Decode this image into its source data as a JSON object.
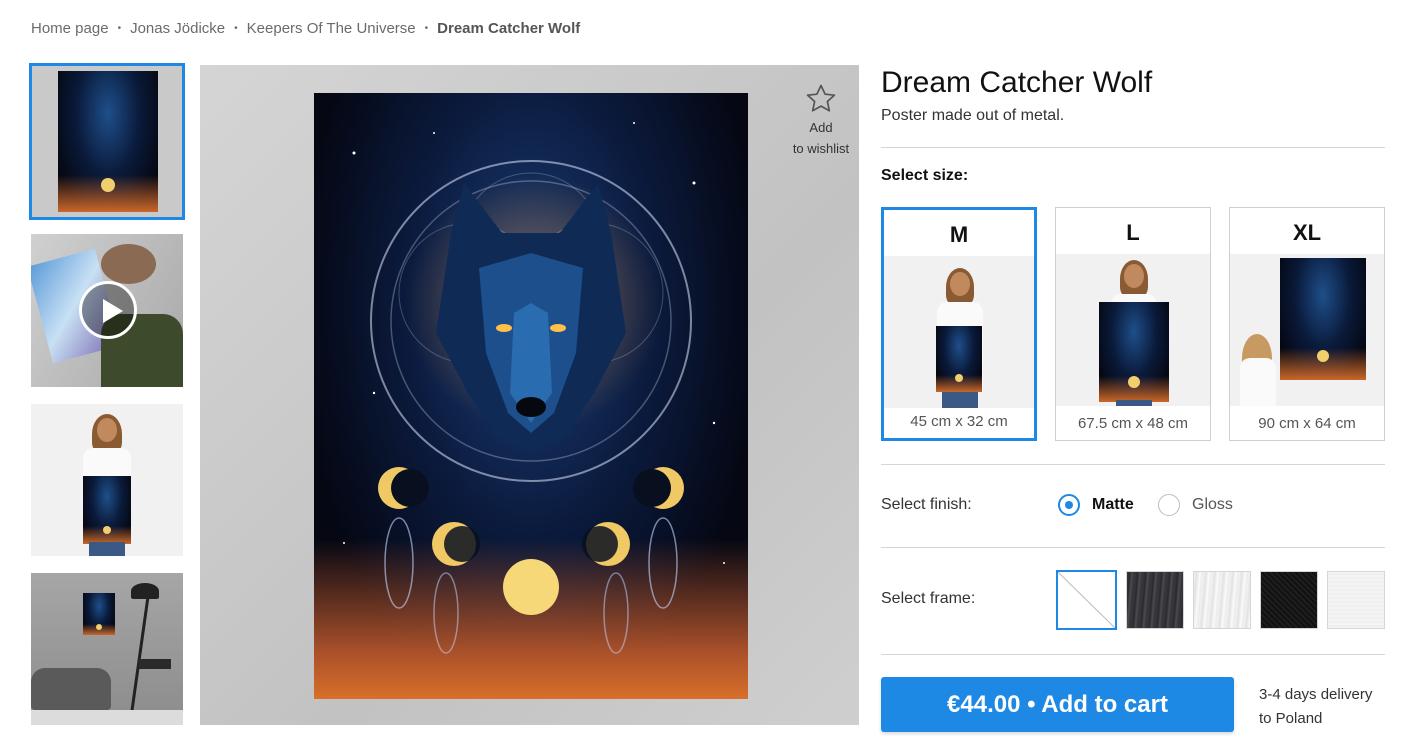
{
  "breadcrumb": {
    "items": [
      "Home page",
      "Jonas Jödicke",
      "Keepers Of The Universe"
    ],
    "current": "Dream Catcher Wolf",
    "separator": "•"
  },
  "wishlist": {
    "line1": "Add",
    "line2": "to wishlist",
    "icon": "star-outline-icon"
  },
  "product": {
    "title": "Dream Catcher Wolf",
    "subtitle": "Poster made out of metal."
  },
  "size": {
    "label": "Select size:",
    "options": [
      {
        "size": "M",
        "dimensions": "45 cm x 32 cm",
        "selected": true
      },
      {
        "size": "L",
        "dimensions": "67.5 cm x 48 cm",
        "selected": false
      },
      {
        "size": "XL",
        "dimensions": "90 cm x 64 cm",
        "selected": false
      }
    ]
  },
  "finish": {
    "label": "Select finish:",
    "options": [
      {
        "label": "Matte",
        "selected": true
      },
      {
        "label": "Gloss",
        "selected": false
      }
    ]
  },
  "frame": {
    "label": "Select frame:",
    "options": [
      "none",
      "dark-wood",
      "white-wood",
      "black-wood",
      "white"
    ]
  },
  "cart": {
    "label": "€44.00 • Add to cart"
  },
  "delivery": {
    "line1": "3-4 days delivery",
    "line2": "to Poland"
  },
  "colors": {
    "accent": "#1e88e5"
  }
}
